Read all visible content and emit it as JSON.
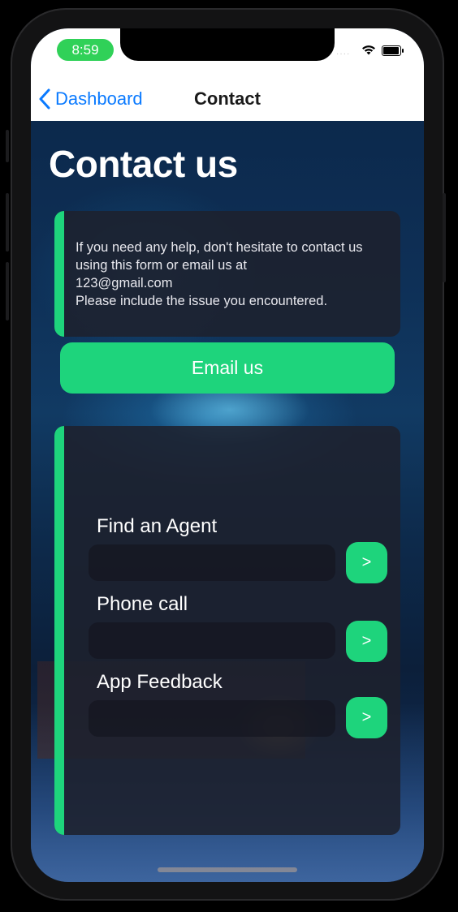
{
  "status": {
    "time": "8:59",
    "signal_dots": "····"
  },
  "nav": {
    "back_label": "Dashboard",
    "title": "Contact"
  },
  "page": {
    "heading": "Contact us"
  },
  "info": {
    "text": "If you need any help, don't hesitate to contact us using this form or email us at\n 123@gmail.com\nPlease include the issue you encountered."
  },
  "email_button": {
    "label": "Email us"
  },
  "options": [
    {
      "label": "Find an Agent",
      "go": ">"
    },
    {
      "label": "Phone call",
      "go": ">"
    },
    {
      "label": "App Feedback",
      "go": ">"
    }
  ],
  "colors": {
    "accent_green": "#1ed47c",
    "ios_blue": "#0a7aff",
    "status_green": "#30d158"
  },
  "icons": {
    "back": "chevron-left-icon",
    "wifi": "wifi-icon",
    "battery": "battery-icon"
  }
}
